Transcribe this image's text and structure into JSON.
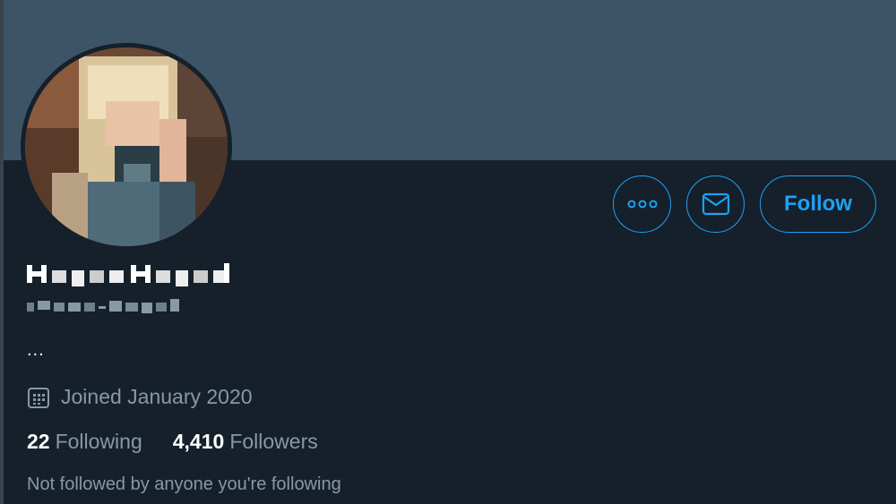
{
  "profile": {
    "display_name": "Hayes Hazard",
    "handle": "@hayes_hazard",
    "bio": "...",
    "joined_label": "Joined January 2020",
    "following_count": "22",
    "following_label": "Following",
    "followers_count": "4,410",
    "followers_label": "Followers",
    "not_followed_text": "Not followed by anyone you're following"
  },
  "actions": {
    "follow_label": "Follow"
  },
  "icons": {
    "more": "more-horizontal-icon",
    "message": "envelope-icon",
    "calendar": "calendar-icon"
  },
  "colors": {
    "background": "#15202b",
    "banner": "#3d5466",
    "accent": "#1da1f2",
    "secondary_text": "#8899a6",
    "primary_text": "#ffffff"
  }
}
